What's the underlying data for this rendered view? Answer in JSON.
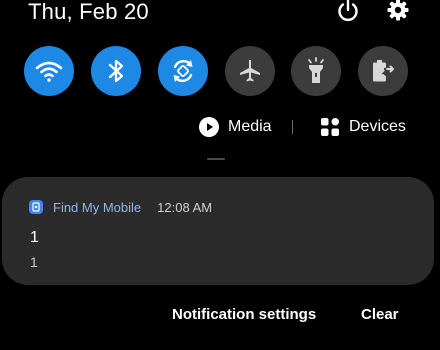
{
  "status": {
    "date": "Thu, Feb 20",
    "power_icon": "power-icon",
    "settings_icon": "gear-icon"
  },
  "quick_tiles": [
    {
      "name": "Wi-Fi",
      "icon": "wifi-icon",
      "state": "on"
    },
    {
      "name": "Bluetooth",
      "icon": "bluetooth-icon",
      "state": "on"
    },
    {
      "name": "Auto rotate",
      "icon": "auto-rotate-icon",
      "state": "on"
    },
    {
      "name": "Airplane mode",
      "icon": "airplane-icon",
      "state": "off"
    },
    {
      "name": "Flashlight",
      "icon": "flashlight-icon",
      "state": "off"
    },
    {
      "name": "Power saving",
      "icon": "battery-saver-icon",
      "state": "off"
    }
  ],
  "media_row": {
    "media_label": "Media",
    "devices_label": "Devices"
  },
  "notification": {
    "app_name": "Find My Mobile",
    "time": "12:08 AM",
    "title": "1",
    "body": "1"
  },
  "actions": {
    "settings_label": "Notification settings",
    "clear_label": "Clear"
  },
  "colors": {
    "accent": "#1e88e5",
    "tile_off": "#3c3c3c",
    "card": "#2b2b2b",
    "background": "#000000"
  }
}
